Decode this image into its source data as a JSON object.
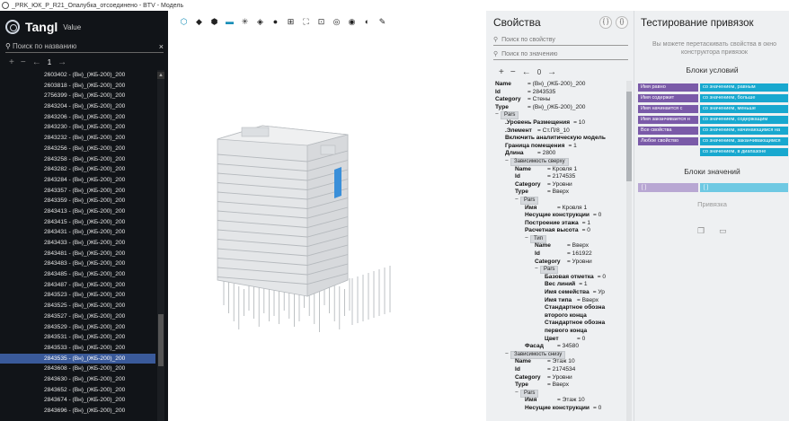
{
  "window": {
    "title": "_PRK_ЮК_P_R21_Опалубка_отсоединено - BTV - Модель"
  },
  "brand": {
    "name": "Tangl",
    "edition": "Value"
  },
  "left_search": {
    "placeholder": "Поиск по названию"
  },
  "left_pager": {
    "page": "1"
  },
  "elements": [
    "2603402 - (Вн)_(ЖБ-200)_200",
    "2603818 - (Вн)_(ЖБ-200)_200",
    "2756399 - (Вн)_(ЖБ-200)_200",
    "2843204 - (Вн)_(ЖБ-200)_200",
    "2843206 - (Вн)_(ЖБ-200)_200",
    "2843230 - (Вн)_(ЖБ-200)_200",
    "2843232 - (Вн)_(ЖБ-200)_200",
    "2843256 - (Вн)_(ЖБ-200)_200",
    "2843258 - (Вн)_(ЖБ-200)_200",
    "2843282 - (Вн)_(ЖБ-200)_200",
    "2843284 - (Вн)_(ЖБ-200)_200",
    "2843357 - (Вн)_(ЖБ-200)_200",
    "2843359 - (Вн)_(ЖБ-200)_200",
    "2843413 - (Вн)_(ЖБ-200)_200",
    "2843415 - (Вн)_(ЖБ-200)_200",
    "2843431 - (Вн)_(ЖБ-200)_200",
    "2843433 - (Вн)_(ЖБ-200)_200",
    "2843481 - (Вн)_(ЖБ-200)_200",
    "2843483 - (Вн)_(ЖБ-200)_200",
    "2843485 - (Вн)_(ЖБ-200)_200",
    "2843487 - (Вн)_(ЖБ-200)_200",
    "2843523 - (Вн)_(ЖБ-200)_200",
    "2843525 - (Вн)_(ЖБ-200)_200",
    "2843527 - (Вн)_(ЖБ-200)_200",
    "2843529 - (Вн)_(ЖБ-200)_200",
    "2843531 - (Вн)_(ЖБ-200)_200",
    "2843533 - (Вн)_(ЖБ-200)_200",
    "2843535 - (Вн)_(ЖБ-200)_200",
    "2843608 - (Вн)_(ЖБ-200)_200",
    "2843630 - (Вн)_(ЖБ-200)_200",
    "2843652 - (Вн)_(ЖБ-200)_200",
    "2843674 - (Вн)_(ЖБ-200)_200",
    "2843696 - (Вн)_(ЖБ-200)_200"
  ],
  "selected_index": 27,
  "props": {
    "title": "Свойства",
    "btn_code": "{ }",
    "btn_json": "{}",
    "search_property_placeholder": "Поиск по свойству",
    "search_value_placeholder": "Поиск по значению",
    "page": "0",
    "tree": [
      {
        "d": 0,
        "k": "Name",
        "v": "= (Вн)_(ЖБ-200)_200"
      },
      {
        "d": 0,
        "k": "Id",
        "v": "= 2843535"
      },
      {
        "d": 0,
        "k": "Category",
        "v": "= Стены"
      },
      {
        "d": 0,
        "k": "Type",
        "v": "= (Вн)_(ЖБ-200)_200"
      },
      {
        "d": 0,
        "tag": "Pars",
        "t": "−"
      },
      {
        "d": 1,
        "k": ".Уровень Размещения",
        "v": "= 10"
      },
      {
        "d": 1,
        "k": ".Элемент",
        "v": "= Ст.П/8_10"
      },
      {
        "d": 1,
        "k": "Включить аналитическую модель",
        "v": ""
      },
      {
        "d": 1,
        "k": "Граница помещения",
        "v": "= 1"
      },
      {
        "d": 1,
        "k": "Длина",
        "v": "= 2800"
      },
      {
        "d": 1,
        "tag": "Зависимость сверху",
        "t": "−"
      },
      {
        "d": 2,
        "k": "Name",
        "v": "= Кровля 1"
      },
      {
        "d": 2,
        "k": "Id",
        "v": "= 2174535"
      },
      {
        "d": 2,
        "k": "Category",
        "v": "= Уровни"
      },
      {
        "d": 2,
        "k": "Type",
        "v": "= Вверх"
      },
      {
        "d": 2,
        "tag": "Pars",
        "t": "−"
      },
      {
        "d": 3,
        "k": "Имя",
        "v": "= Кровля 1"
      },
      {
        "d": 3,
        "k": "Несущие конструкции",
        "v": "= 0"
      },
      {
        "d": 3,
        "k": "Построение этажа",
        "v": "= 1"
      },
      {
        "d": 3,
        "k": "Расчетная высота",
        "v": "= 0"
      },
      {
        "d": 3,
        "tag": "Тип",
        "t": "−"
      },
      {
        "d": 4,
        "k": "Name",
        "v": "= Вверх"
      },
      {
        "d": 4,
        "k": "Id",
        "v": "= 161922"
      },
      {
        "d": 4,
        "k": "Category",
        "v": "= Уровни"
      },
      {
        "d": 4,
        "tag": "Pars",
        "t": "−"
      },
      {
        "d": 5,
        "k": "Базовая отметка",
        "v": "= 0"
      },
      {
        "d": 5,
        "k": "Вес линий",
        "v": "= 1"
      },
      {
        "d": 5,
        "k": "Имя семейства",
        "v": "= Ур"
      },
      {
        "d": 5,
        "k": "Имя типа",
        "v": "= Вверх"
      },
      {
        "d": 5,
        "k": "Стандартное обозна",
        "v": ""
      },
      {
        "d": 5,
        "k": "второго конца",
        "v": ""
      },
      {
        "d": 5,
        "k": "Стандартное обозна",
        "v": ""
      },
      {
        "d": 5,
        "k": "первого конца",
        "v": ""
      },
      {
        "d": 5,
        "k": "Цвет",
        "v": "= 0"
      },
      {
        "d": 3,
        "k": "Фасад",
        "v": "= 34580"
      },
      {
        "d": 1,
        "tag": "Зависимость снизу",
        "t": "−"
      },
      {
        "d": 2,
        "k": "Name",
        "v": "= Этаж 10"
      },
      {
        "d": 2,
        "k": "Id",
        "v": "= 2174534"
      },
      {
        "d": 2,
        "k": "Category",
        "v": "= Уровни"
      },
      {
        "d": 2,
        "k": "Type",
        "v": "= Вверх"
      },
      {
        "d": 2,
        "tag": "Pars",
        "t": "−"
      },
      {
        "d": 3,
        "k": "Имя",
        "v": "= Этаж 10"
      },
      {
        "d": 3,
        "k": "Несущие конструкции",
        "v": "= 0"
      }
    ]
  },
  "binding": {
    "title": "Тестирование привязок",
    "hint": "Вы можете перетаскивать свойства в окно конструктора привязок",
    "conditions_title": "Блоки условий",
    "conditions_left": [
      "Имя равно",
      "Имя содержит",
      "Имя начинается с",
      "Имя заканчивается н",
      "Все свойства",
      "Любое свойство"
    ],
    "conditions_right": [
      "со значением, равным",
      "со значением, больше",
      "со значением, меньше",
      "со значением, содержащим",
      "со значением, начинающимся на",
      "со значением, заканчивающимся",
      "со значением, в диапазоне"
    ],
    "values_title": "Блоки значений",
    "value_left": "[ ]",
    "value_right": "[ ]",
    "binding_label": "Привязка"
  },
  "colors": {
    "accent": "#18a8cf",
    "purple": "#7a5aa8",
    "selected": "#3a5a9a"
  }
}
